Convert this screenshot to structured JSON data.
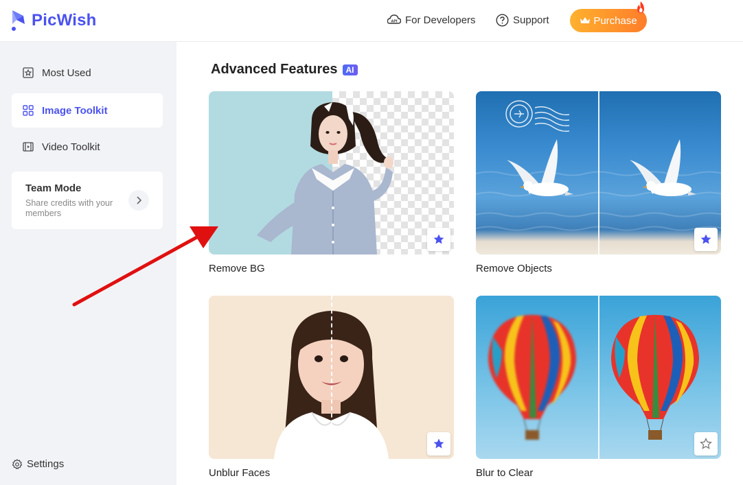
{
  "header": {
    "logo_text": "PicWish",
    "nav": {
      "developers_label": "For Developers",
      "support_label": "Support"
    },
    "purchase_label": "Purchase"
  },
  "sidebar": {
    "items": [
      {
        "label": "Most Used",
        "icon": "star-box-icon"
      },
      {
        "label": "Image Toolkit",
        "icon": "grid-icon",
        "active": true
      },
      {
        "label": "Video Toolkit",
        "icon": "film-icon"
      }
    ],
    "team": {
      "title": "Team Mode",
      "subtitle": "Share credits with your members"
    },
    "settings_label": "Settings"
  },
  "main": {
    "section_title": "Advanced Features",
    "badge": "AI",
    "cards": [
      {
        "label": "Remove BG",
        "favorited": true
      },
      {
        "label": "Remove Objects",
        "favorited": true
      },
      {
        "label": "Unblur Faces",
        "favorited": true
      },
      {
        "label": "Blur to Clear",
        "favorited": false
      }
    ]
  },
  "colors": {
    "brand": "#4b52ef",
    "purchase_start": "#ffb12e",
    "purchase_end": "#ff7d2a",
    "sidebar_bg": "#f2f3f7",
    "annotation_arrow": "#e01010"
  }
}
